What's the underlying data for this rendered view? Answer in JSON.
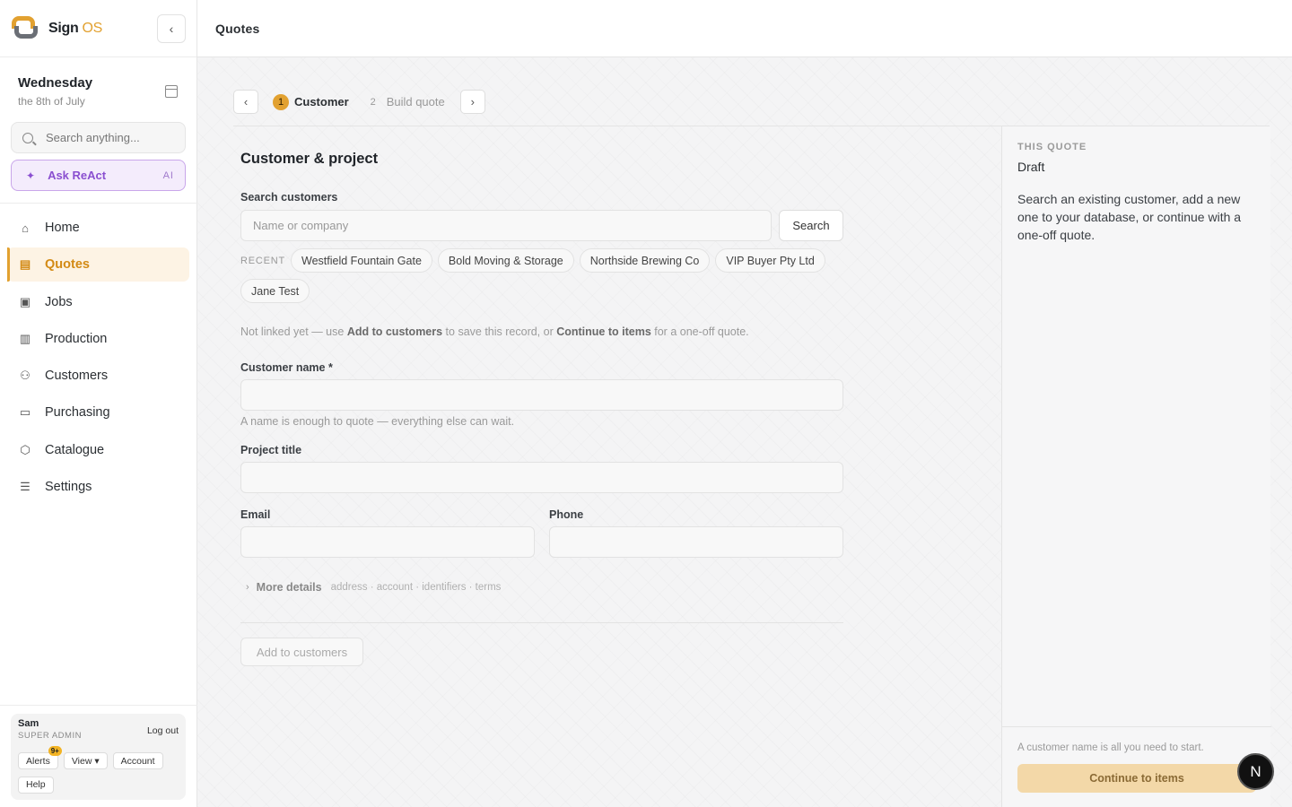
{
  "brand": {
    "name": "Sign",
    "suffix": "OS",
    "accent": "#e2a130"
  },
  "header": {
    "title": "Quotes"
  },
  "date": {
    "day": "Wednesday",
    "sub": "the 8th of July"
  },
  "search": {
    "placeholder": "Search anything..."
  },
  "ask": {
    "label": "Ask ReAct",
    "tag": "AI"
  },
  "nav": {
    "items": [
      {
        "label": "Home",
        "icon": "home-icon"
      },
      {
        "label": "Quotes",
        "icon": "document-icon"
      },
      {
        "label": "Jobs",
        "icon": "clipboard-icon"
      },
      {
        "label": "Production",
        "icon": "bar-chart-icon"
      },
      {
        "label": "Customers",
        "icon": "users-icon"
      },
      {
        "label": "Purchasing",
        "icon": "monitor-icon"
      },
      {
        "label": "Catalogue",
        "icon": "box-icon"
      },
      {
        "label": "Settings",
        "icon": "sliders-icon"
      }
    ]
  },
  "user": {
    "name": "Sam",
    "role": "SUPER ADMIN",
    "logout": "Log out",
    "alerts": "Alerts",
    "alerts_badge": "9+",
    "view": "View ▾",
    "account": "Account",
    "help": "Help"
  },
  "stepper": {
    "prev": "‹",
    "next": "›",
    "steps": [
      {
        "num": "1",
        "label": "Customer"
      },
      {
        "num": "2",
        "label": "Build quote"
      }
    ]
  },
  "form": {
    "title": "Customer & project",
    "search_label": "Search customers",
    "search_placeholder": "Name or company",
    "search_button": "Search",
    "recent_label": "RECENT",
    "recent": [
      "Westfield Fountain Gate",
      "Bold Moving & Storage",
      "Northside Brewing Co",
      "VIP Buyer Pty Ltd",
      "Jane Test"
    ],
    "note_a": "Not linked yet — use ",
    "note_b": "Add to customers",
    "note_c": " to save this record, or ",
    "note_d": "Continue to items",
    "note_e": " for a one-off quote.",
    "name_label": "Customer name *",
    "name_value": "",
    "name_hint": "A name is enough to quote — everything else can wait.",
    "project_label": "Project title",
    "project_value": "",
    "email_label": "Email",
    "email_value": "",
    "phone_label": "Phone",
    "phone_value": "",
    "more_label": "More details",
    "more_sub": "address · account · identifiers · terms",
    "add_button": "Add to customers"
  },
  "side": {
    "kicker": "THIS QUOTE",
    "status": "Draft",
    "desc": "Search an existing customer, add a new one to your database, or continue with a one-off quote.",
    "foot_hint": "A customer name is all you need to start.",
    "cta": "Continue to items"
  },
  "dev_badge": "N"
}
